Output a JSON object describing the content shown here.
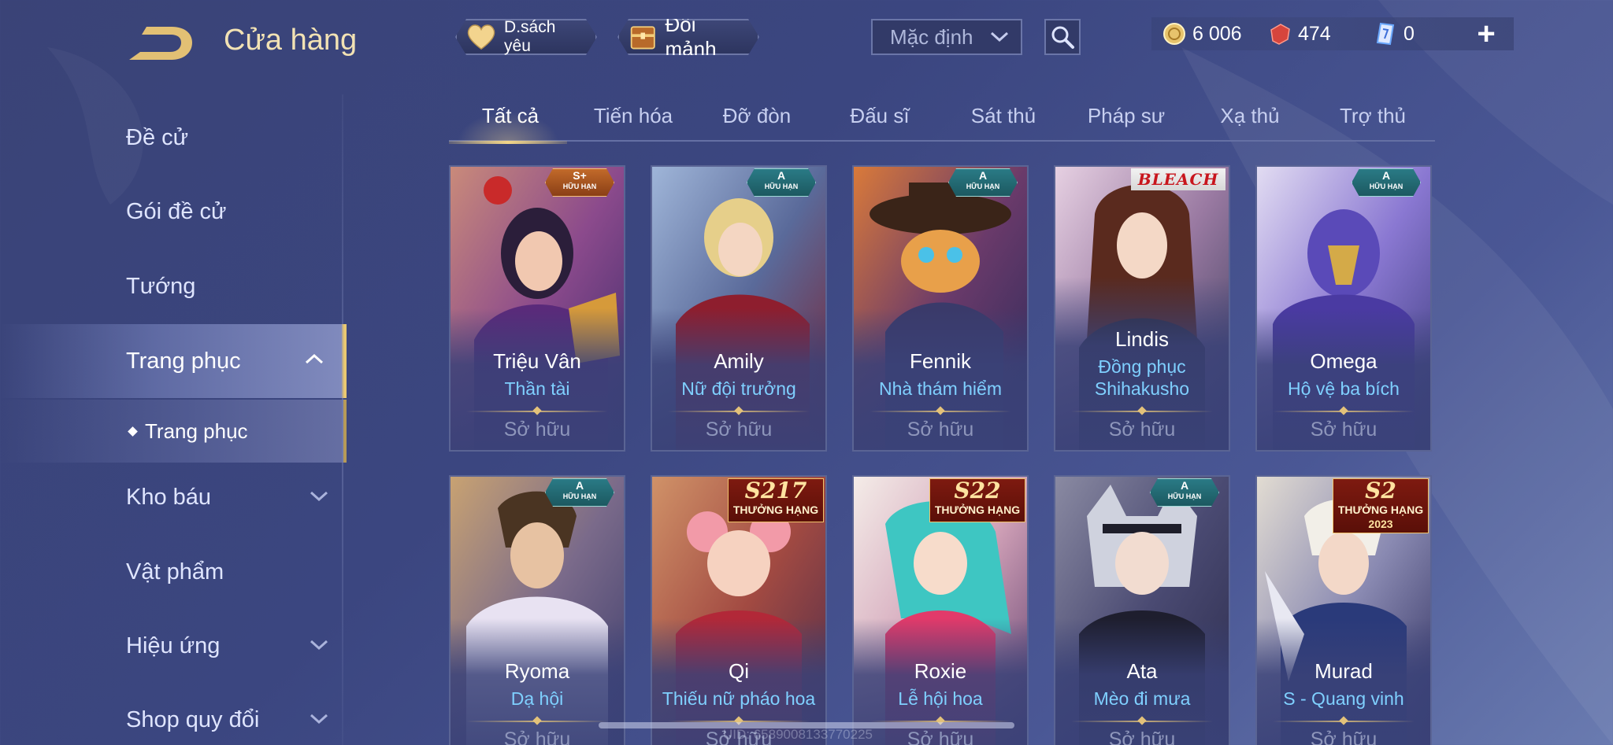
{
  "header": {
    "title": "Cửa hàng",
    "wishlist_label": "D.sách yêu",
    "exchange_label": "Đổi mảnh",
    "sort_value": "Mặc định",
    "currency": {
      "gold": "6 006",
      "ruby": "474",
      "voucher": "0"
    },
    "plus_label": "+"
  },
  "sidebar": {
    "items": [
      {
        "label": "Đề cử"
      },
      {
        "label": "Gói đề cử"
      },
      {
        "label": "Tướng"
      },
      {
        "label": "Trang phục"
      },
      {
        "label": "Kho báu"
      },
      {
        "label": "Vật phẩm"
      },
      {
        "label": "Hiệu ứng"
      },
      {
        "label": "Shop quy đổi"
      }
    ],
    "sub_item": "Trang phục"
  },
  "tabs": [
    "Tất cả",
    "Tiến hóa",
    "Đỡ đòn",
    "Đấu sĩ",
    "Sát thủ",
    "Pháp sư",
    "Xạ thủ",
    "Trợ thủ"
  ],
  "owned_label": "Sở hữu",
  "cards": [
    {
      "hero": "Triệu Vân",
      "skin": "Thần tài",
      "badge": "S+",
      "badge_sub": "HỮU HẠN"
    },
    {
      "hero": "Amily",
      "skin": "Nữ đội trưởng",
      "badge": "A",
      "badge_sub": "HỮU HẠN"
    },
    {
      "hero": "Fennik",
      "skin": "Nhà thám hiểm",
      "badge": "A",
      "badge_sub": "HỮU HẠN"
    },
    {
      "hero": "Lindis",
      "skin": "Đồng phục",
      "skin2": "Shihakusho",
      "badge": "BLEACH"
    },
    {
      "hero": "Omega",
      "skin": "Hộ vệ ba bích",
      "badge": "A",
      "badge_sub": "HỮU HẠN"
    },
    {
      "hero": "Ryoma",
      "skin": "Dạ hội",
      "badge": "A",
      "badge_sub": "HỮU HẠN"
    },
    {
      "hero": "Qi",
      "skin": "Thiếu nữ pháo hoa",
      "badge": "S217",
      "badge_sub": "THƯỞNG HẠNG"
    },
    {
      "hero": "Roxie",
      "skin": "Lễ hội hoa",
      "badge": "S22",
      "badge_sub": "THƯỞNG HẠNG"
    },
    {
      "hero": "Ata",
      "skin": "Mèo đi mưa",
      "badge": "A",
      "badge_sub": "HỮU HẠN"
    },
    {
      "hero": "Murad",
      "skin": "S - Quang vinh",
      "badge": "S2",
      "badge_sub": "THƯỞNG HẠNG",
      "badge_year": "2023"
    }
  ],
  "footer": {
    "uid": "UID: 6589008133770225"
  },
  "colors": {
    "background": "#3b4680",
    "accent_gold": "#e9c872",
    "skin_text": "#7fd0ff",
    "owned_text": "#8e96bb"
  }
}
